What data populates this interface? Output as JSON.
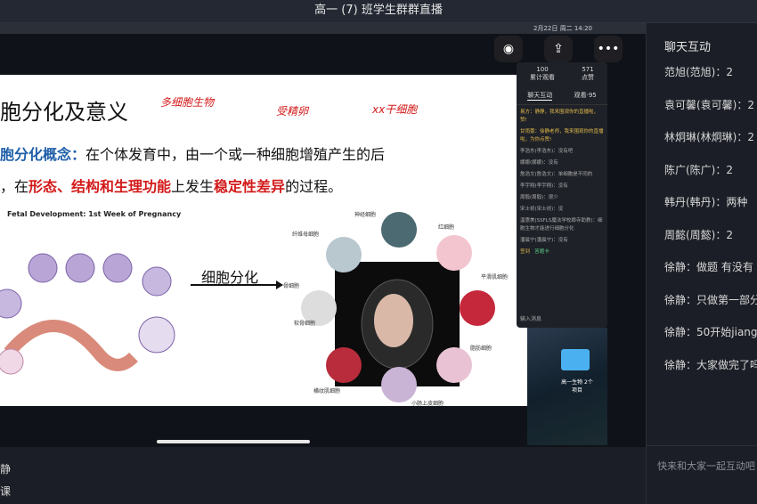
{
  "window": {
    "title": "高一 (7) 班学生群群直播"
  },
  "menubar": {
    "status": "2月22日 周二 14:20"
  },
  "slide": {
    "title": "胞分化及意义",
    "annotations": [
      "多细胞生物",
      "受精卵",
      "xx干细胞"
    ],
    "concept_label": "胞分化概念：",
    "concept_text": "在个体发育中，由一个或一种细胞增殖产生的后",
    "line2_prefix": "，在",
    "line2_red1": "形态、结构和生理功能",
    "line2_mid": "上发生",
    "line2_red2": "稳定性差异",
    "line2_suffix": "的过程。",
    "fetal_title": "Fetal Development: 1st Week of Pregnancy",
    "diff_label": "细胞分化",
    "cell_labels": [
      "神经细胞",
      "红细胞",
      "平滑肌细胞",
      "骨细胞",
      "纤维母细胞",
      "软骨细胞",
      "脂肪细胞",
      "小肠上皮细胞",
      "横纹肌细胞"
    ]
  },
  "toolbar": {
    "icons": [
      "camera-icon",
      "share-icon",
      "more-icon"
    ]
  },
  "mini_chat": {
    "stat1_value": "100",
    "stat1_label": "累计观看",
    "stat2_value": "571",
    "stat2_label": "点赞",
    "tab_chat": "聊天互动",
    "tab_viewers": "观看·95",
    "messages": [
      "易方：静静，我来围观你的直播啦，赞!",
      "甘雨蕾：徐静老师，我来围观你的直播啦，为你点赞!",
      "李浩东(李浩东)：没有吧",
      "娜娜(娜娜)：没有",
      "詹浩文(詹浩文)：单细胞是不同的",
      "李宇翔(李宇翔)：没有",
      "周毅(周毅)：很少",
      "宋士祯(宋士祯)：没",
      "温惠美(SSFLS魔法学校廊寺助教)：细胞生物才能进行细胞分化",
      "潘晨宁(潘晨宁)：没有"
    ],
    "sign_btn": "签到",
    "answer_btn": "答题卡",
    "input_placeholder": "输入消息"
  },
  "desktop": {
    "folder_label": "高一生物 2个项目"
  },
  "chat_panel": {
    "header": "聊天互动",
    "items": [
      "范旭(范旭)：2",
      "袁可馨(袁可馨)：2",
      "林炯琳(林炯琳)：2",
      "陈广(陈广)：2",
      "韩丹(韩丹)：两种",
      "周懿(周懿)：2",
      "徐静：做题 有没有 多",
      "徐静：只做第一部分",
      "徐静：50开始jiang",
      "徐静：大家做完了吗"
    ],
    "input_placeholder": "快来和大家一起互动吧"
  },
  "bottom": {
    "line1": "静",
    "line2": "课"
  }
}
